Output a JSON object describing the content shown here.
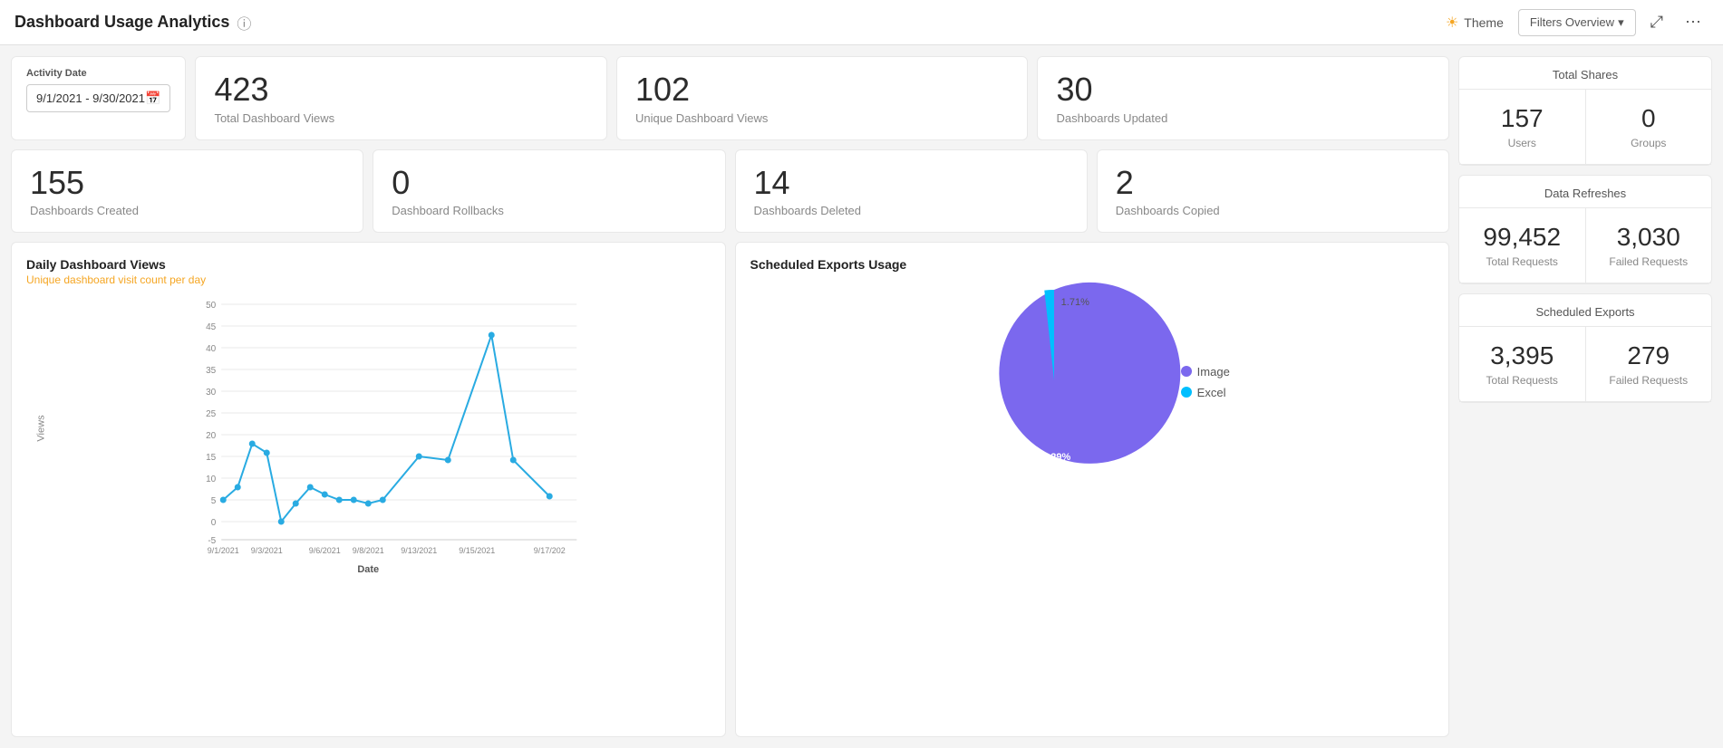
{
  "header": {
    "title": "Dashboard Usage Analytics",
    "info_icon": "ⓘ",
    "theme_label": "Theme",
    "filters_label": "Filters Overview",
    "expand_icon": "⤢",
    "more_icon": "⋯"
  },
  "date_filter": {
    "label": "Activity Date",
    "value": "9/1/2021 - 9/30/2021"
  },
  "kpi_row1": [
    {
      "number": "423",
      "label": "Total Dashboard Views"
    },
    {
      "number": "102",
      "label": "Unique Dashboard Views"
    },
    {
      "number": "30",
      "label": "Dashboards Updated"
    }
  ],
  "kpi_row2": [
    {
      "number": "155",
      "label": "Dashboards Created"
    },
    {
      "number": "0",
      "label": "Dashboard Rollbacks"
    },
    {
      "number": "14",
      "label": "Dashboards Deleted"
    },
    {
      "number": "2",
      "label": "Dashboards Copied"
    }
  ],
  "line_chart": {
    "title": "Daily Dashboard Views",
    "subtitle": "Unique dashboard visit count per day",
    "x_label": "Date",
    "y_label": "Views",
    "x_ticks": [
      "9/1/2021",
      "9/3/2021",
      "9/6/2021",
      "9/8/2021",
      "9/13/2021",
      "9/15/2021",
      "9/17/202"
    ],
    "y_ticks": [
      "-5",
      "0",
      "5",
      "10",
      "15",
      "20",
      "25",
      "30",
      "35",
      "40",
      "45",
      "50"
    ],
    "data_points": [
      {
        "x": 0,
        "y": 5
      },
      {
        "x": 15,
        "y": 7
      },
      {
        "x": 32,
        "y": 14
      },
      {
        "x": 48,
        "y": 12
      },
      {
        "x": 62,
        "y": 2
      },
      {
        "x": 78,
        "y": 4
      },
      {
        "x": 93,
        "y": 8
      },
      {
        "x": 108,
        "y": 7
      },
      {
        "x": 122,
        "y": 5
      },
      {
        "x": 137,
        "y": 5
      },
      {
        "x": 152,
        "y": 4
      },
      {
        "x": 167,
        "y": 5
      },
      {
        "x": 185,
        "y": 15
      },
      {
        "x": 207,
        "y": 14
      },
      {
        "x": 228,
        "y": 43
      },
      {
        "x": 248,
        "y": 14
      },
      {
        "x": 263,
        "y": 6
      }
    ]
  },
  "pie_chart": {
    "title": "Scheduled Exports Usage",
    "segments": [
      {
        "label": "Image",
        "value": 98.29,
        "color": "#7B68EE"
      },
      {
        "label": "Excel",
        "value": 1.71,
        "color": "#00BFFF"
      }
    ]
  },
  "right_panel": {
    "total_shares": {
      "title": "Total Shares",
      "users": {
        "number": "157",
        "label": "Users"
      },
      "groups": {
        "number": "0",
        "label": "Groups"
      }
    },
    "data_refreshes": {
      "title": "Data Refreshes",
      "total_requests": {
        "number": "99,452",
        "label": "Total Requests"
      },
      "failed_requests": {
        "number": "3,030",
        "label": "Failed Requests"
      }
    },
    "scheduled_exports": {
      "title": "Scheduled Exports",
      "total_requests": {
        "number": "3,395",
        "label": "Total Requests"
      },
      "failed_requests": {
        "number": "279",
        "label": "Failed Requests"
      }
    }
  }
}
